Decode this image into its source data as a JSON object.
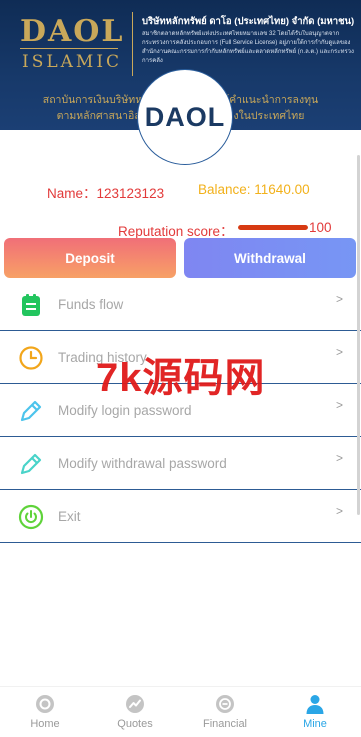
{
  "banner": {
    "brand_main": "DAOL",
    "brand_sub": "ISLAMIC",
    "company_name": "บริษัทหลักทรัพย์ ดาโอ (ประเทศไทย) จำกัด (มหาชน)",
    "company_desc": "สมาชิกตลาดหลักทรัพย์แห่งประเทศไทยหมายเลข 32 โดยได้รับใบอนุญาตจากกระทรวงการคลังประกอบการ (Full Service License) อยู่ภายใต้การกำกับดูแลของสำนักงานคณะกรรมการกำกับหลักทรัพย์และตลาดหลักทรัพย์ (ก.ล.ต.) และกระทรวงการคลัง",
    "tagline_1": "สถาบันการเงินบริษัทหลักทรัพย์ชั้นนำ ผู้ให้คำแนะนำการลงทุน",
    "tagline_2": "ตามหลักศาสนาอิสลามที่ได้รับการรับรองในประเทศไทย"
  },
  "logo": {
    "text": "DAOL"
  },
  "user": {
    "name_label": "Name：123123123",
    "balance_label": "Balance: 11640.00",
    "reputation_label": "Reputation score：",
    "reputation_value": "100",
    "reputation_fraction": 1.0
  },
  "actions": {
    "deposit": "Deposit",
    "withdrawal": "Withdrawal"
  },
  "menu": [
    {
      "label": "Funds flow",
      "icon": "clipboard-icon",
      "chevron": ">"
    },
    {
      "label": "Trading history",
      "icon": "clock-icon",
      "chevron": ">"
    },
    {
      "label": "Modify login password",
      "icon": "pencil-icon",
      "chevron": ">"
    },
    {
      "label": "Modify withdrawal password",
      "icon": "pencil-icon",
      "chevron": ">"
    },
    {
      "label": "Exit",
      "icon": "power-icon",
      "chevron": ">"
    }
  ],
  "watermark": "7k源码网",
  "bottom_nav": [
    {
      "label": "Home",
      "icon": "home-icon"
    },
    {
      "label": "Quotes",
      "icon": "quotes-icon"
    },
    {
      "label": "Financial",
      "icon": "financial-icon"
    },
    {
      "label": "Mine",
      "icon": "user-icon",
      "active": true
    }
  ],
  "colors": {
    "banner_bg": "#0f2c55",
    "gold": "#c9a85a",
    "name_red": "#e23a3a",
    "balance_yellow": "#f2b11b",
    "deposit_gradient_start": "#f06f78",
    "withdrawal_gradient": "#7f86f2",
    "active_nav": "#2aa6e6",
    "divider": "#2d5b94"
  }
}
